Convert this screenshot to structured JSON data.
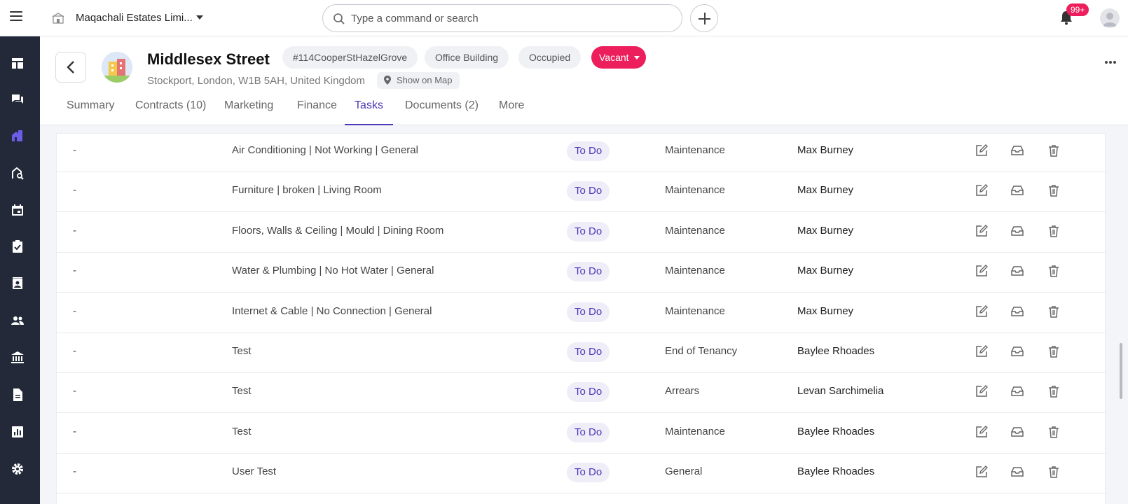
{
  "topbar": {
    "org_name": "Maqachali Estates Limi...",
    "search_placeholder": "Type a command or search",
    "notifications_badge": "99+"
  },
  "sidebar": {
    "items": [
      "dashboard-icon",
      "chat-icon",
      "properties-icon",
      "property-search-icon",
      "calendar-icon",
      "tasks-icon",
      "contacts-icon",
      "people-icon",
      "bank-icon",
      "document-icon",
      "reports-icon",
      "settings-icon"
    ],
    "active": "properties-icon",
    "active_color": "#6c5ce7"
  },
  "property": {
    "name": "Middlesex Street",
    "reference": "#114CooperStHazelGrove",
    "type": "Office Building",
    "occupancy": "Occupied",
    "status": "Vacant",
    "address": "Stockport, London, W1B 5AH, United Kingdom",
    "map_label": "Show on Map"
  },
  "tabs": [
    {
      "label": "Summary"
    },
    {
      "label": "Contracts (10)"
    },
    {
      "label": "Marketing"
    },
    {
      "label": "Finance"
    },
    {
      "label": "Tasks",
      "active": true
    },
    {
      "label": "Documents (2)"
    },
    {
      "label": "More"
    }
  ],
  "tasks": [
    {
      "ref": "-",
      "title": "Air Conditioning | Not Working | General",
      "status": "To Do",
      "category": "Maintenance",
      "assignee": "Max Burney"
    },
    {
      "ref": "-",
      "title": "Furniture | broken | Living Room",
      "status": "To Do",
      "category": "Maintenance",
      "assignee": "Max Burney"
    },
    {
      "ref": "-",
      "title": "Floors, Walls & Ceiling | Mould | Dining Room",
      "status": "To Do",
      "category": "Maintenance",
      "assignee": "Max Burney"
    },
    {
      "ref": "-",
      "title": "Water & Plumbing | No Hot Water | General",
      "status": "To Do",
      "category": "Maintenance",
      "assignee": "Max Burney"
    },
    {
      "ref": "-",
      "title": "Internet & Cable | No Connection | General",
      "status": "To Do",
      "category": "Maintenance",
      "assignee": "Max Burney"
    },
    {
      "ref": "-",
      "title": "Test",
      "status": "To Do",
      "category": "End of Tenancy",
      "assignee": "Baylee Rhoades"
    },
    {
      "ref": "-",
      "title": "Test",
      "status": "To Do",
      "category": "Arrears",
      "assignee": "Levan Sarchimelia"
    },
    {
      "ref": "-",
      "title": "Test",
      "status": "To Do",
      "category": "Maintenance",
      "assignee": "Baylee Rhoades"
    },
    {
      "ref": "-",
      "title": "User Test",
      "status": "To Do",
      "category": "General",
      "assignee": "Baylee Rhoades"
    }
  ],
  "colors": {
    "accent": "#4b38b8",
    "status_vacant": "#ec1e5c",
    "sidebar_bg": "#232939"
  }
}
